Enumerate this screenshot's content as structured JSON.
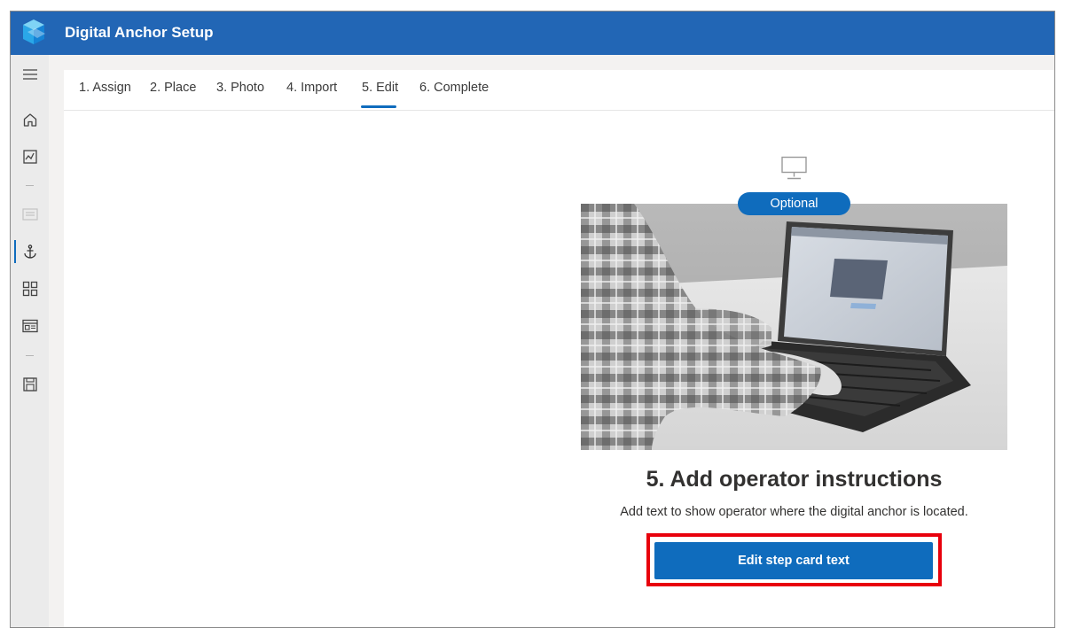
{
  "app": {
    "title": "Digital Anchor Setup"
  },
  "nav": [
    {
      "name": "menu",
      "icon": "hamburger-menu-icon"
    },
    {
      "name": "home",
      "icon": "home-icon"
    },
    {
      "name": "analytics",
      "icon": "analytics-icon"
    },
    {
      "name": "guides",
      "icon": "guides-icon",
      "disabled": true
    },
    {
      "name": "anchor",
      "icon": "anchor-icon",
      "active": true
    },
    {
      "name": "grid",
      "icon": "grid-icon"
    },
    {
      "name": "dashboard",
      "icon": "dashboard-icon"
    },
    {
      "name": "save",
      "icon": "save-icon"
    }
  ],
  "tabs": [
    {
      "label": "1. Assign"
    },
    {
      "label": "2. Place"
    },
    {
      "label": "3. Photo"
    },
    {
      "label": "4. Import"
    },
    {
      "label": "5. Edit",
      "active": true
    },
    {
      "label": "6. Complete"
    }
  ],
  "step": {
    "badge": "Optional",
    "icon": "monitor-icon",
    "heading": "5. Add operator instructions",
    "description": "Add text to show operator where the digital anchor is located.",
    "button_label": "Edit step card text"
  },
  "colors": {
    "title_bar": "#2266b5",
    "accent": "#0f6cbd",
    "highlight": "#e8000c"
  }
}
